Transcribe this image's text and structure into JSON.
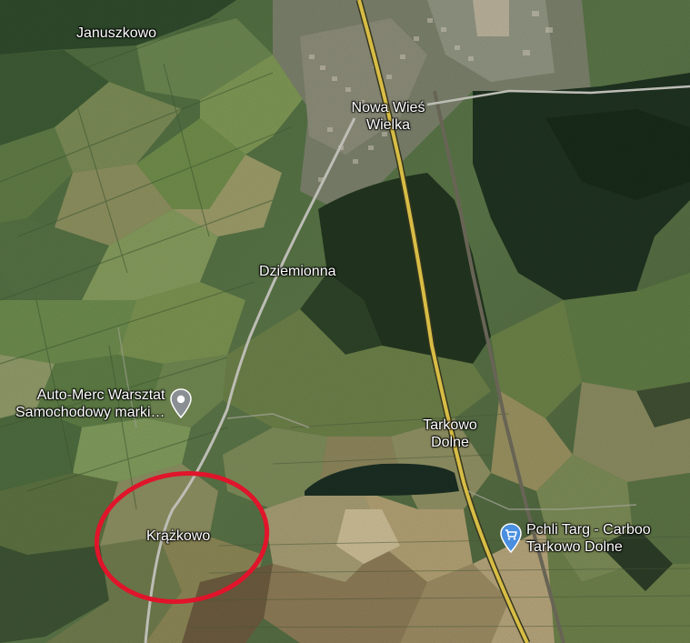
{
  "map": {
    "view": "satellite",
    "places": {
      "januszkowo": "Januszkowo",
      "nowa_wies_wielka": [
        "Nowa Wieś",
        "Wielka"
      ],
      "dziemionna": "Dziemionna",
      "tarkowo_dolne": [
        "Tarkowo",
        "Dolne"
      ],
      "krazkowo": "Krążkowo"
    },
    "pois": {
      "auto_merc": {
        "lines": [
          "Auto-Merc Warsztat",
          "Samochodowy marki…"
        ],
        "icon": "map-pin-icon",
        "pin_color": "#8a8f93"
      },
      "pchli_targ": {
        "lines": [
          "Pchli Targ - Carboo",
          "Tarkowo Dolne"
        ],
        "icon": "shopping-cart-pin-icon",
        "pin_color": "#4a8fe0"
      }
    },
    "highlight": {
      "shape": "ellipse",
      "color": "#e0142a",
      "marks": "Krążkowo"
    }
  }
}
